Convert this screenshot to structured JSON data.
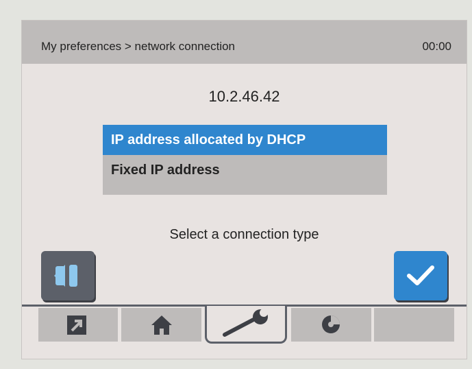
{
  "header": {
    "breadcrumb": "My preferences > network connection",
    "clock": "00:00"
  },
  "ip_address": "10.2.46.42",
  "connection_options": [
    {
      "label": "IP address allocated by DHCP",
      "selected": true
    },
    {
      "label": "Fixed IP address",
      "selected": false
    }
  ],
  "prompt": "Select a connection type",
  "buttons": {
    "back_icon": "back-icon",
    "confirm_icon": "check-icon"
  },
  "tabs": [
    {
      "icon": "shortcut-arrow-icon",
      "active": false
    },
    {
      "icon": "home-icon",
      "active": false
    },
    {
      "icon": "wrench-icon",
      "active": true
    },
    {
      "icon": "disc-icon",
      "active": false
    },
    {
      "icon": "",
      "active": false
    }
  ],
  "colors": {
    "accent": "#2f86ce",
    "header_bg": "#bebbba",
    "dark": "#5c6069",
    "screen_bg": "#e8e3e1"
  }
}
